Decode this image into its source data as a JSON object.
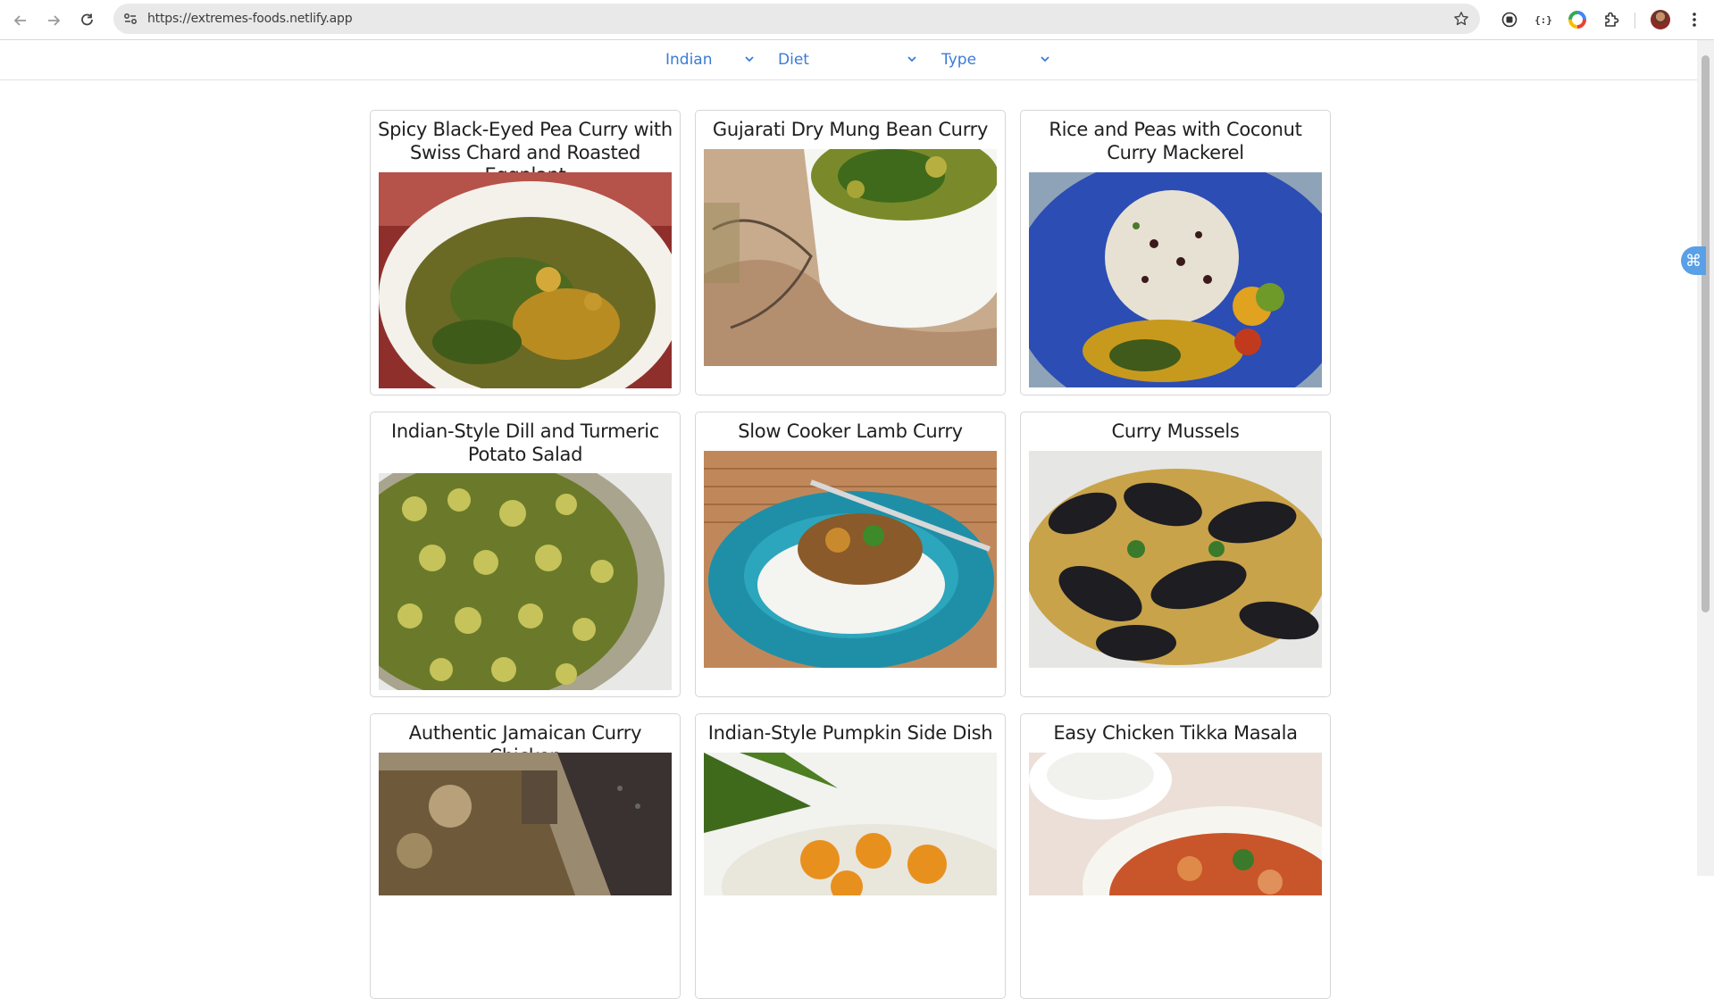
{
  "browser": {
    "url": "https://extremes-foods.netlify.app",
    "icons": {
      "back": "back-arrow-icon",
      "forward": "forward-arrow-icon",
      "reload": "reload-icon",
      "site_info": "site-settings-icon",
      "bookmark": "star-icon",
      "record": "record-icon",
      "ext_code": "{:}",
      "chrome_color": "color-wheel-icon",
      "extensions": "puzzle-icon",
      "menu": "kebab-menu-icon"
    }
  },
  "filters": {
    "cuisine": "Indian",
    "diet": "Diet",
    "type": "Type"
  },
  "accent_color": "#3b7bd6",
  "recipes": [
    {
      "title": "Spicy Black-Eyed Pea Curry with Swiss Chard and Roasted Eggplant",
      "image": "green curry bowl"
    },
    {
      "title": "Gujarati Dry Mung Bean Curry",
      "image": "mung bean bowl"
    },
    {
      "title": "Rice and Peas with Coconut Curry Mackerel",
      "image": "rice on blue plate"
    },
    {
      "title": "Indian-Style Dill and Turmeric Potato Salad",
      "image": "potato salad tray"
    },
    {
      "title": "Slow Cooker Lamb Curry",
      "image": "lamb curry on rice"
    },
    {
      "title": "Curry Mussels",
      "image": "mussels"
    },
    {
      "title": "Authentic Jamaican Curry Chicken",
      "image": "curry chicken dish"
    },
    {
      "title": "Indian-Style Pumpkin Side Dish",
      "image": "pumpkin dish"
    },
    {
      "title": "Easy Chicken Tikka Masala",
      "image": "tikka masala bowl"
    }
  ]
}
